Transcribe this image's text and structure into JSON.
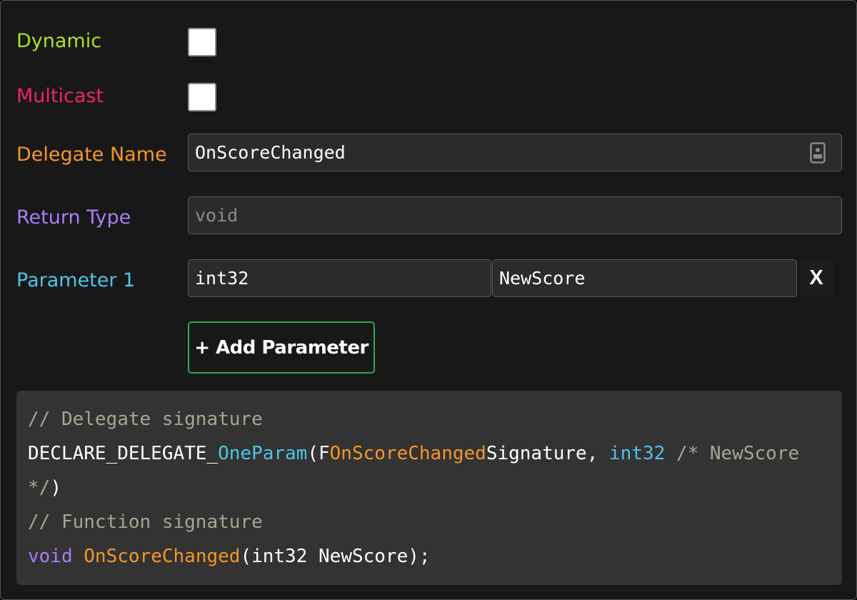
{
  "labels": {
    "dynamic": {
      "text": "Dynamic",
      "color": "#a6e22e"
    },
    "multicast": {
      "text": "Multicast",
      "color": "#f0245e"
    },
    "delegate_name": {
      "text": "Delegate Name",
      "color": "#f5962a"
    },
    "return_type": {
      "text": "Return Type",
      "color": "#a77ef5"
    },
    "parameter_1": {
      "text": "Parameter 1",
      "color": "#4fc3e8"
    }
  },
  "checkboxes": {
    "dynamic_checked": false,
    "multicast_checked": false
  },
  "fields": {
    "delegate_name_value": "OnScoreChanged",
    "delegate_name_icon": "contact-card-icon",
    "return_type_placeholder": "void",
    "param1_type_value": "int32",
    "param1_name_value": "NewScore"
  },
  "buttons": {
    "remove_param_label": "X",
    "add_param_label": "+ Add Parameter",
    "add_param_border_color": "#2ea94f"
  },
  "code": {
    "line1_comment": "// Delegate signature",
    "line2_macro_prefix": "DECLARE_DELEGATE_",
    "line2_macro_suffix": "OneParam",
    "line2_paren_open": "(",
    "line2_f_prefix": "F",
    "line2_name": "OnScoreChanged",
    "line2_signature": "Signature, ",
    "line2_type": "int32",
    "line2_space": " ",
    "line2_comment": "/* NewScore */",
    "line2_close": ")",
    "line3_comment": "// Function signature",
    "line4_key": "void",
    "line4_space": " ",
    "line4_name": "OnScoreChanged",
    "line4_rest": "(int32 NewScore);"
  }
}
